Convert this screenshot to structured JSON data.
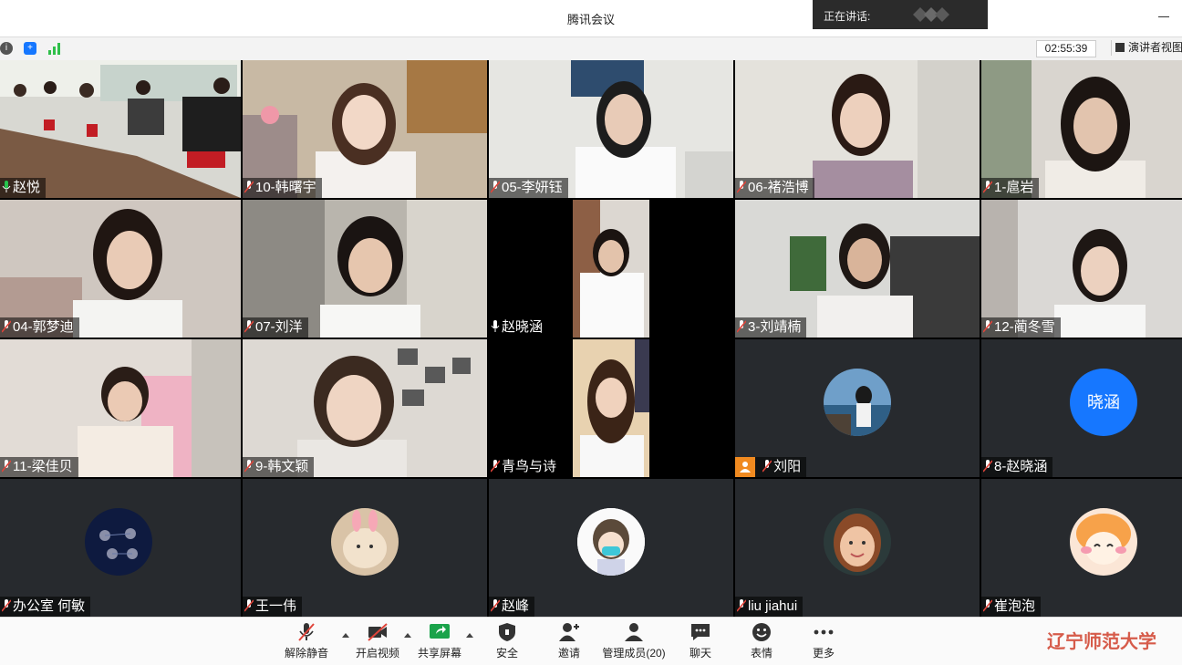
{
  "window": {
    "title": "腾讯会议"
  },
  "speaking": {
    "label": "正在讲话:"
  },
  "meeting": {
    "timer": "02:55:39",
    "view_label": "演讲者视图"
  },
  "participants": [
    {
      "name": "赵悦",
      "mic": "on"
    },
    {
      "name": "10-韩曙宇",
      "mic": "muted"
    },
    {
      "name": "05-李妍钰",
      "mic": "muted"
    },
    {
      "name": "06-褚浩博",
      "mic": "muted"
    },
    {
      "name": "1-扈岩",
      "mic": "muted"
    },
    {
      "name": "04-郭梦迪",
      "mic": "muted"
    },
    {
      "name": "07-刘洋",
      "mic": "muted"
    },
    {
      "name": "赵晓涵",
      "mic": "on"
    },
    {
      "name": "3-刘靖楠",
      "mic": "muted"
    },
    {
      "name": "12-蔺冬雪",
      "mic": "muted"
    },
    {
      "name": "11-梁佳贝",
      "mic": "muted"
    },
    {
      "name": "9-韩文颖",
      "mic": "muted"
    },
    {
      "name": "青鸟与诗",
      "mic": "muted"
    },
    {
      "name": "刘阳",
      "mic": "muted"
    },
    {
      "name": "8-赵晓涵",
      "mic": "muted"
    },
    {
      "name": "办公室 何敏",
      "mic": "muted"
    },
    {
      "name": "王一伟",
      "mic": "muted"
    },
    {
      "name": "赵峰",
      "mic": "muted"
    },
    {
      "name": "liu jiahui",
      "mic": "muted"
    },
    {
      "name": "崔泡泡",
      "mic": "muted"
    }
  ],
  "avatar_text": {
    "xiaohan": "晓涵"
  },
  "toolbar": {
    "unmute": "解除静音",
    "start_video": "开启视频",
    "share_screen": "共享屏幕",
    "security": "安全",
    "invite": "邀请",
    "manage_members": "管理成员(20)",
    "chat": "聊天",
    "reactions": "表情",
    "more": "更多"
  },
  "watermark": {
    "text": "辽宁师范大学"
  },
  "colors": {
    "accent": "#1677ff",
    "muted_mic": "#e0443a",
    "tile_bg": "#272a2e"
  }
}
